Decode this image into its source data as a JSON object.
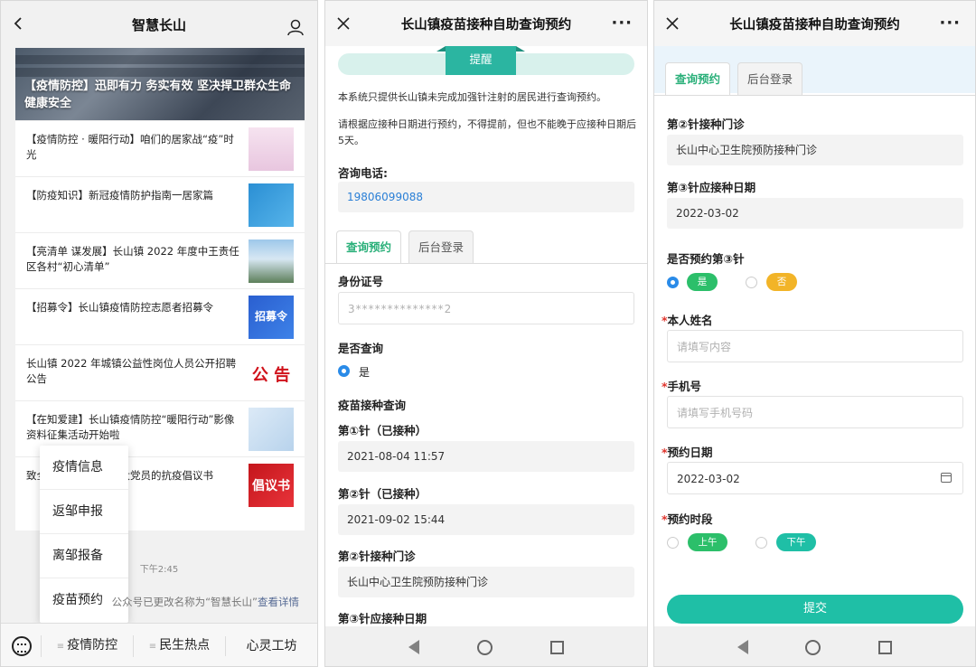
{
  "panel1": {
    "title": "智慧长山",
    "banner_title": "【疫情防控】迅即有力  务实有效  坚决捍卫群众生命健康安全",
    "news": [
      {
        "text": "【疫情防控 · 暖阳行动】咱们的居家战“疫”时光",
        "thumb": "thumb-t1",
        "thumb_text": ""
      },
      {
        "text": "【防疫知识】新冠疫情防护指南一居家篇",
        "thumb": "thumb-t2",
        "thumb_text": ""
      },
      {
        "text": "【亮清单 谋发展】长山镇 2022 年度中王责任区各村“初心清单”",
        "thumb": "thumb-t3",
        "thumb_text": ""
      },
      {
        "text": "【招募令】长山镇疫情防控志愿者招募令",
        "thumb": "thumb-t4",
        "thumb_text": "招募令"
      },
      {
        "text": "长山镇 2022 年城镇公益性岗位人员公开招聘公告",
        "thumb": "thumb-t5",
        "thumb_text": "公 告"
      },
      {
        "text": "【在知爱建】长山镇疫情防控“暖阳行动”影像资料征集活动开始啦",
        "thumb": "thumb-t6",
        "thumb_text": ""
      },
      {
        "text": "致全镇广大干部和广大党员的抗疫倡议书",
        "thumb": "thumb-t7",
        "thumb_text": "倡议书"
      }
    ],
    "popup_items": [
      "疫情信息",
      "返邹申报",
      "离邹报备",
      "疫苗预约"
    ],
    "time": "下午2:45",
    "notice_prefix": "公众号已更改名称为“智慧长山”",
    "notice_link": "查看详情",
    "tabs": [
      "疫情防控",
      "民生热点",
      "心灵工坊"
    ]
  },
  "panel2": {
    "title": "长山镇疫苗接种自助查询预约",
    "reminder": "提醒",
    "para1": "本系统只提供长山镇未完成加强针注射的居民进行查询预约。",
    "para2": "请根据应接种日期进行预约，不得提前，但也不能晚于应接种日期后5天。",
    "phone_label": "咨询电话:",
    "phone": "19806099088",
    "tab_query": "查询预约",
    "tab_admin": "后台登录",
    "id_label": "身份证号",
    "id_value": "3**************2",
    "query_label": "是否查询",
    "query_yes": "是",
    "vaccine_label": "疫苗接种查询",
    "dose1_label": "第①针（已接种）",
    "dose1_value": "2021-08-04 11:57",
    "dose2_label": "第②针（已接种）",
    "dose2_value": "2021-09-02 15:44",
    "clinic_label": "第②针接种门诊",
    "clinic_value": "长山中心卫生院预防接种门诊",
    "dose3_label": "第③针应接种日期"
  },
  "panel3": {
    "title": "长山镇疫苗接种自助查询预约",
    "tab_query": "查询预约",
    "tab_admin": "后台登录",
    "clinic_label": "第②针接种门诊",
    "clinic_value": "长山中心卫生院预防接种门诊",
    "dose3_label": "第③针应接种日期",
    "dose3_value": "2022-03-02",
    "book3_label": "是否预约第③针",
    "yes": "是",
    "no": "否",
    "name_label": "本人姓名",
    "name_placeholder": "请填写内容",
    "mobile_label": "手机号",
    "mobile_placeholder": "请填写手机号码",
    "date_label": "预约日期",
    "date_value": "2022-03-02",
    "slot_label": "预约时段",
    "morning": "上午",
    "afternoon": "下午",
    "submit": "提交",
    "req_mark": "*"
  }
}
